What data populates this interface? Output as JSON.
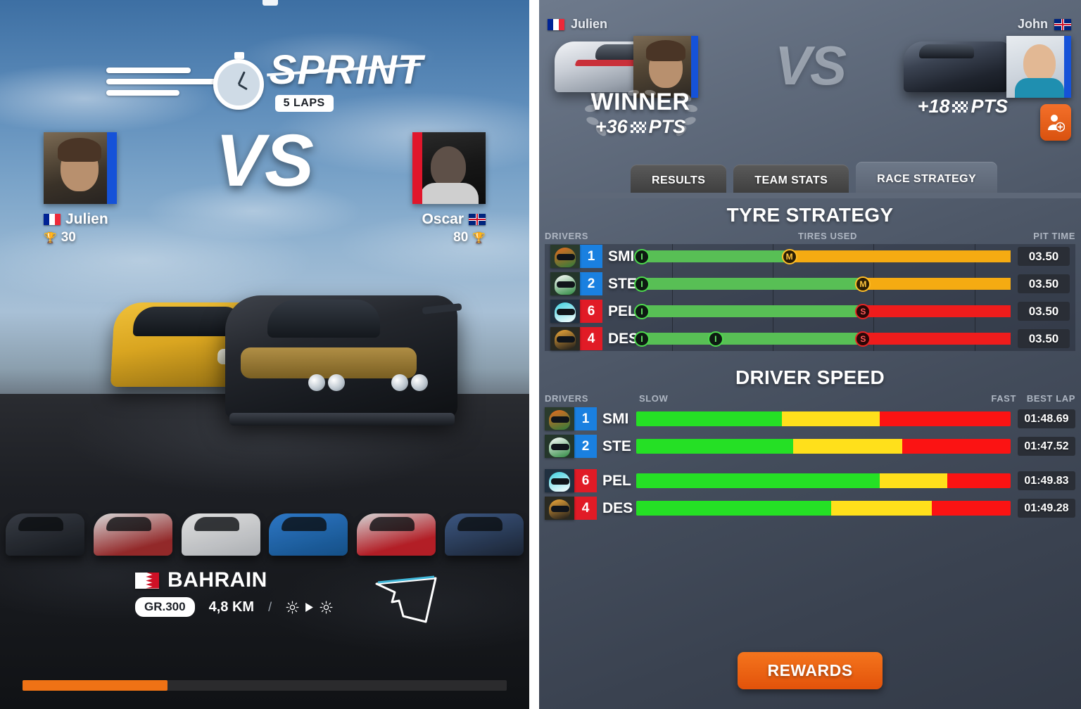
{
  "left": {
    "mode": {
      "title": "SPRINT",
      "laps_badge": "5 LAPS",
      "icon": "stopwatch-icon"
    },
    "vs_label": "VS",
    "players": [
      {
        "name": "Julien",
        "flag": "flag-france-icon",
        "trophies": "30",
        "trophy_icon": "trophy-icon",
        "accent": "#1552d8"
      },
      {
        "name": "Oscar",
        "flag": "flag-uk-icon",
        "trophies": "80",
        "trophy_icon": "trophy-icon",
        "accent": "#e0162b"
      }
    ],
    "track": {
      "country": "BAHRAIN",
      "flag": "flag-bahrain-icon",
      "class_badge": "GR.300",
      "length": "4,8 KM",
      "separator": "/",
      "weather_start": "sun-icon",
      "weather_arrow": "arrow-right-icon",
      "weather_end": "sun-icon",
      "map_icon": "track-map-icon"
    },
    "loading": {
      "percent": 30
    }
  },
  "right": {
    "vs_label": "VS",
    "left_player": {
      "name": "Julien",
      "flag": "flag-france-icon",
      "car_icon": "race-car-silver-icon",
      "avatar": "avatar-julien",
      "result_label": "WINNER",
      "points": "+36",
      "points_suffix": "PTS",
      "points_icon": "checkered-flag-icon"
    },
    "right_player": {
      "name": "John",
      "flag": "flag-uk-icon",
      "car_icon": "race-car-dark-icon",
      "avatar": "avatar-john",
      "points": "+18",
      "points_suffix": "PTS",
      "points_icon": "checkered-flag-icon",
      "add_friend_icon": "add-friend-icon"
    },
    "tabs": [
      {
        "label": "RESULTS",
        "active": false
      },
      {
        "label": "TEAM STATS",
        "active": false
      },
      {
        "label": "RACE STRATEGY",
        "active": true
      }
    ],
    "tyre_strategy": {
      "title": "TYRE STRATEGY",
      "col_drivers": "DRIVERS",
      "col_center": "TIRES USED",
      "col_right": "PIT TIME",
      "rows": [
        {
          "helmet": "helmet-smi-icon",
          "pos": "1",
          "team": "blue",
          "code": "SMI",
          "pit_time": "03.50",
          "segments": [
            {
              "color": "green",
              "pct": 40
            },
            {
              "color": "orange",
              "pct": 60
            }
          ],
          "markers": [
            {
              "compound": "I",
              "pct": 0
            },
            {
              "compound": "M",
              "pct": 40
            }
          ]
        },
        {
          "helmet": "helmet-ste-icon",
          "pos": "2",
          "team": "blue",
          "code": "STE",
          "pit_time": "03.50",
          "segments": [
            {
              "color": "green",
              "pct": 60
            },
            {
              "color": "orange",
              "pct": 40
            }
          ],
          "markers": [
            {
              "compound": "I",
              "pct": 0
            },
            {
              "compound": "M",
              "pct": 60
            }
          ]
        },
        {
          "helmet": "helmet-pel-icon",
          "pos": "6",
          "team": "red",
          "code": "PEL",
          "pit_time": "03.50",
          "segments": [
            {
              "color": "green",
              "pct": 60
            },
            {
              "color": "red",
              "pct": 40
            }
          ],
          "markers": [
            {
              "compound": "I",
              "pct": 0
            },
            {
              "compound": "S",
              "pct": 60
            }
          ]
        },
        {
          "helmet": "helmet-des-icon",
          "pos": "4",
          "team": "red",
          "code": "DES",
          "pit_time": "03.50",
          "segments": [
            {
              "color": "green",
              "pct": 60
            },
            {
              "color": "red",
              "pct": 40
            }
          ],
          "markers": [
            {
              "compound": "I",
              "pct": 0
            },
            {
              "compound": "I",
              "pct": 20
            },
            {
              "compound": "S",
              "pct": 60
            }
          ]
        }
      ]
    },
    "driver_speed": {
      "title": "DRIVER SPEED",
      "col_drivers": "DRIVERS",
      "col_slow": "SLOW",
      "col_fast": "FAST",
      "col_right": "BEST LAP",
      "rows": [
        {
          "helmet": "helmet-smi-icon",
          "pos": "1",
          "team": "blue",
          "code": "SMI",
          "best_lap": "01:48.69",
          "segments": [
            {
              "color": "green",
              "pct": 39
            },
            {
              "color": "yellow",
              "pct": 26
            },
            {
              "color": "red",
              "pct": 35
            }
          ]
        },
        {
          "helmet": "helmet-ste-icon",
          "pos": "2",
          "team": "blue",
          "code": "STE",
          "best_lap": "01:47.52",
          "segments": [
            {
              "color": "green",
              "pct": 42
            },
            {
              "color": "yellow",
              "pct": 29
            },
            {
              "color": "red",
              "pct": 29
            }
          ]
        },
        {
          "helmet": "helmet-pel-icon",
          "pos": "6",
          "team": "red",
          "code": "PEL",
          "best_lap": "01:49.83",
          "segments": [
            {
              "color": "green",
              "pct": 65
            },
            {
              "color": "yellow",
              "pct": 18
            },
            {
              "color": "red",
              "pct": 17
            }
          ]
        },
        {
          "helmet": "helmet-des-icon",
          "pos": "4",
          "team": "red",
          "code": "DES",
          "best_lap": "01:49.28",
          "segments": [
            {
              "color": "green",
              "pct": 52
            },
            {
              "color": "yellow",
              "pct": 27
            },
            {
              "color": "red",
              "pct": 21
            }
          ]
        }
      ]
    },
    "rewards_button": "REWARDS"
  },
  "colors": {
    "accent_orange": "#ef7215",
    "team_blue": "#1a80e0",
    "team_red": "#e11b26",
    "tyre_soft": "#ef1c1c",
    "tyre_medium": "#f5ab12",
    "tyre_inter": "#58bf55"
  }
}
